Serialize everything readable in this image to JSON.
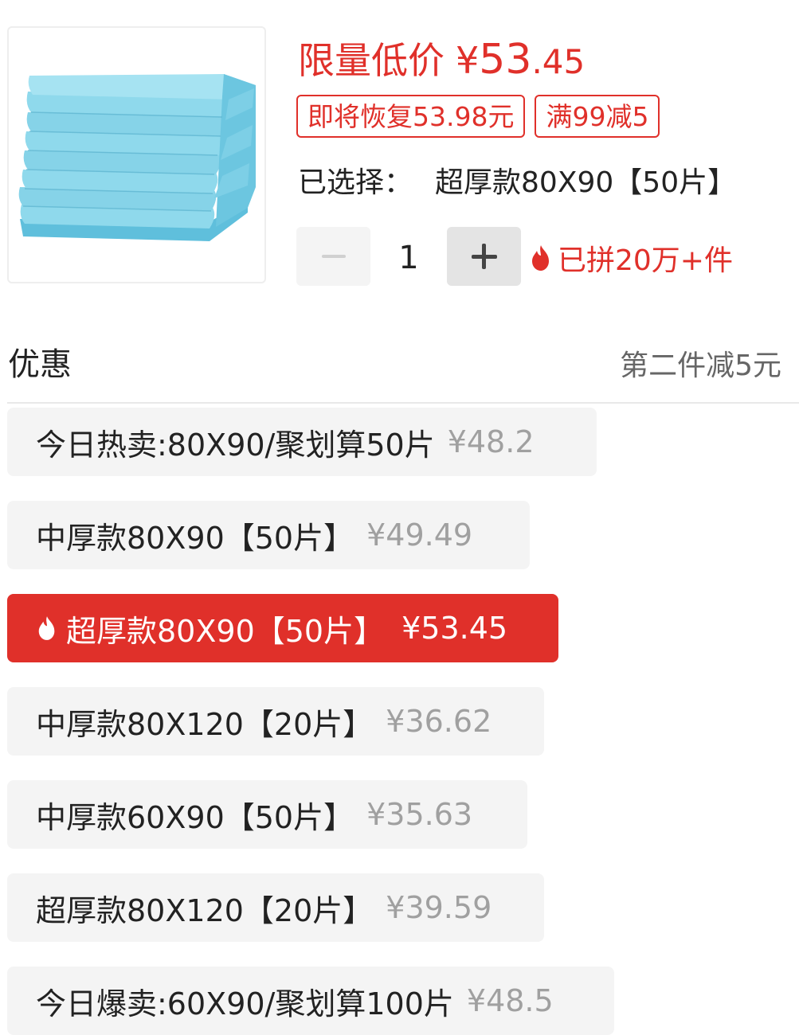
{
  "product": {
    "price_label": "限量低价",
    "price_symbol": "¥",
    "price_integer": "53",
    "price_decimal": ".45",
    "tags": [
      "即将恢复53.98元",
      "满99减5"
    ],
    "selected_label": "已选择：",
    "selected_value": "超厚款80X90【50片】",
    "quantity": "1",
    "sold_text": "已拼20万+件"
  },
  "promotion": {
    "label": "优惠",
    "value": "第二件减5元"
  },
  "skus": [
    {
      "name": "今日热卖:80X90/聚划算50片",
      "price": "¥48.2"
    },
    {
      "name": "中厚款80X90【50片】",
      "price": "¥49.49"
    },
    {
      "name": "超厚款80X90【50片】",
      "price": "¥53.45",
      "selected": true
    },
    {
      "name": "中厚款80X120【20片】",
      "price": "¥36.62"
    },
    {
      "name": "中厚款60X90【50片】",
      "price": "¥35.63"
    },
    {
      "name": "超厚款80X120【20片】",
      "price": "¥39.59"
    },
    {
      "name": "今日爆卖:60X90/聚划算100片",
      "price": "¥48.5"
    }
  ],
  "colors": {
    "accent": "#e0302a",
    "chip_bg": "#f4f4f4",
    "muted_price": "#a0a0a0"
  },
  "icons": {
    "flame": "flame-icon",
    "minus": "minus-icon",
    "plus": "plus-icon"
  }
}
